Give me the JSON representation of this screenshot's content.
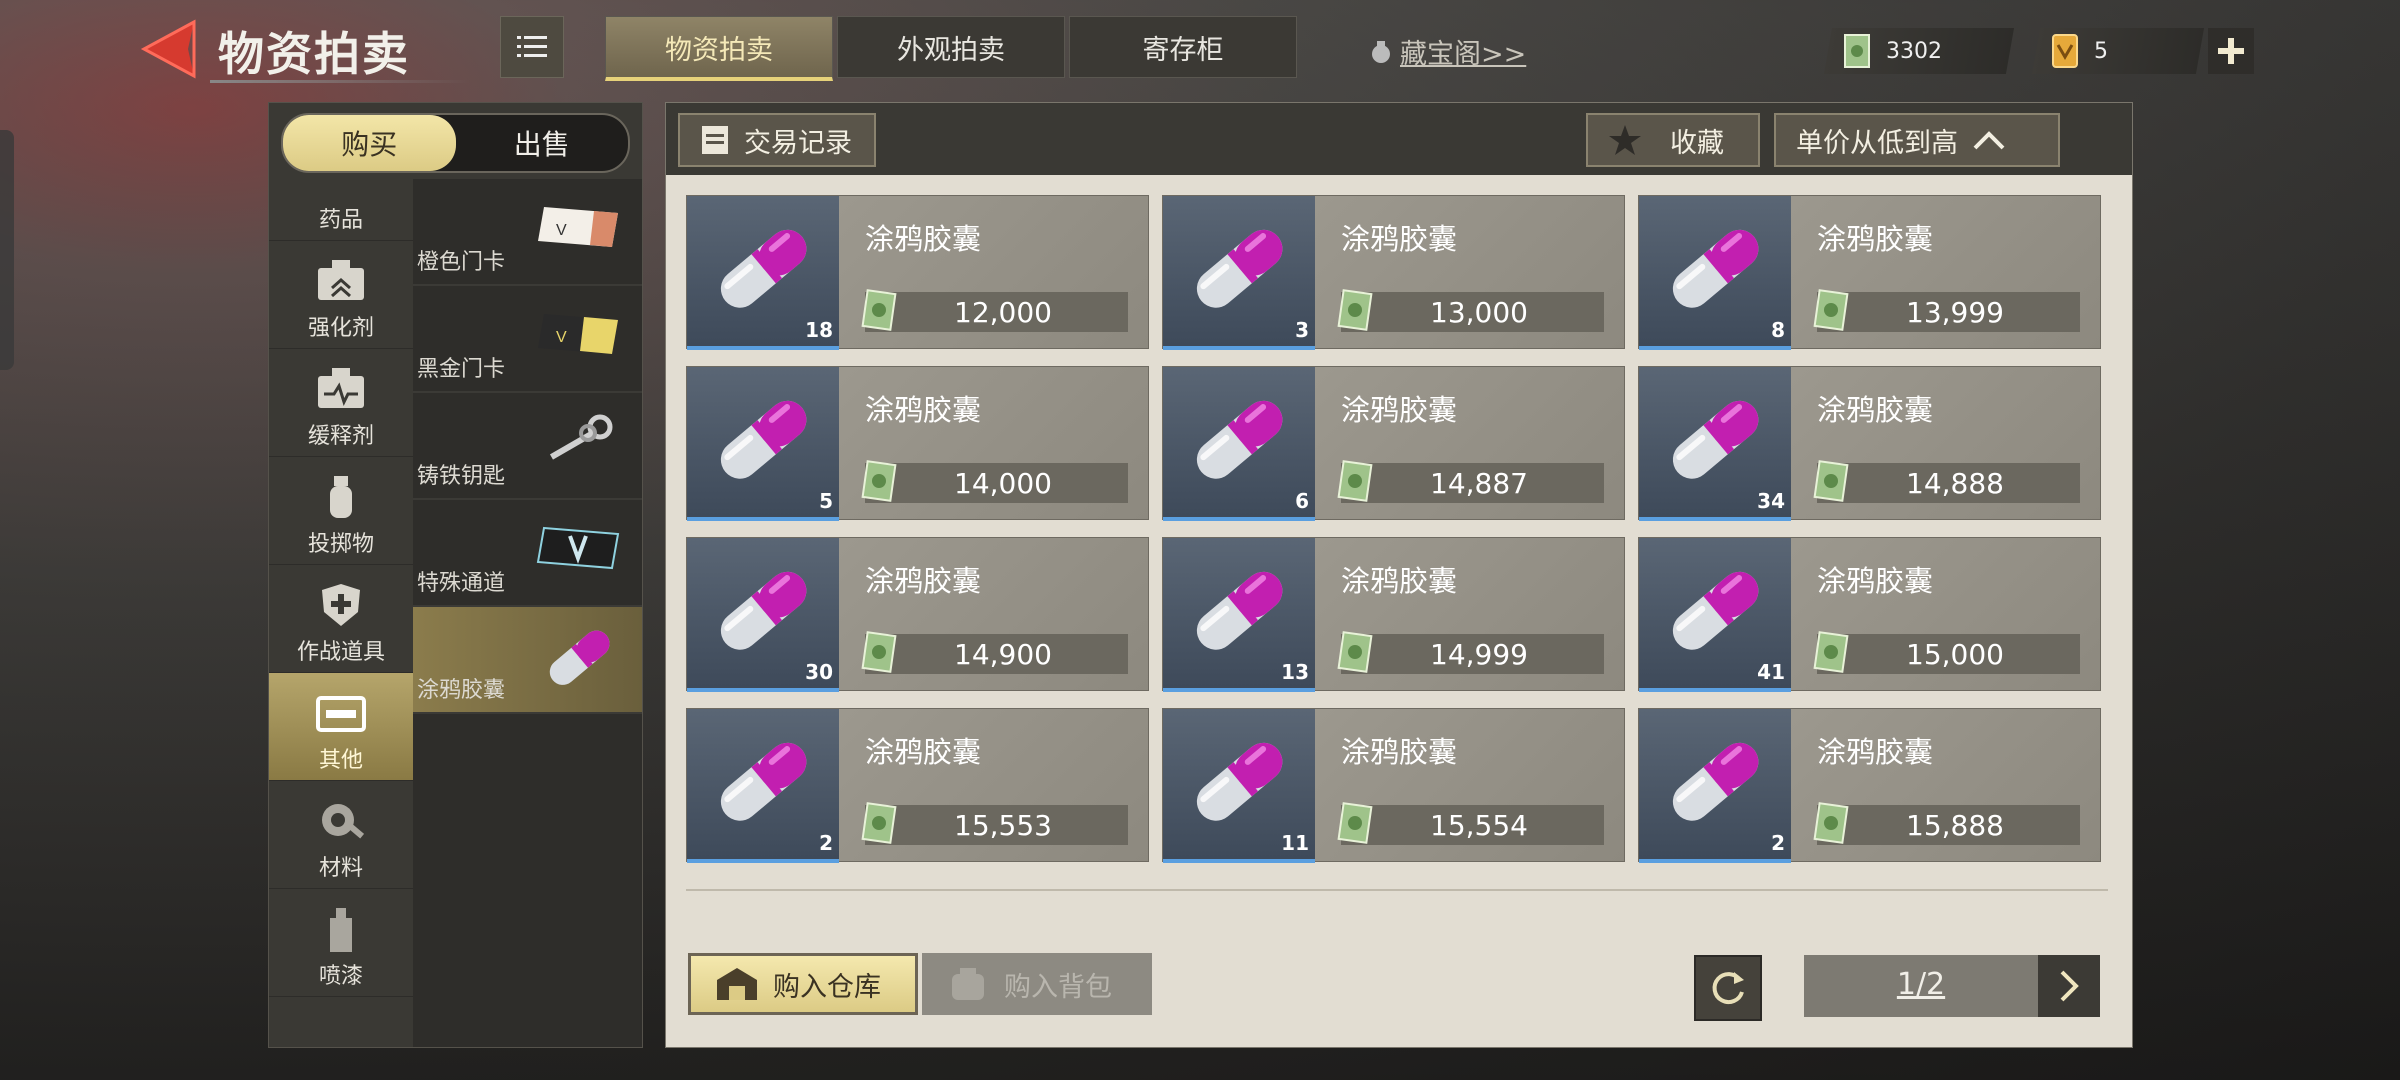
{
  "header": {
    "title": "物资拍卖",
    "tabs": [
      {
        "label": "物资拍卖",
        "active": true
      },
      {
        "label": "外观拍卖",
        "active": false
      },
      {
        "label": "寄存柜",
        "active": false
      }
    ],
    "treasure_link": "藏宝阁>>",
    "currency_cash": "3302",
    "currency_tickets": "5"
  },
  "sidebar": {
    "buy_label": "购买",
    "sell_label": "出售",
    "categories": [
      {
        "label": "药品",
        "icon": "medicine-icon"
      },
      {
        "label": "强化剂",
        "icon": "enhancer-icon"
      },
      {
        "label": "缓释剂",
        "icon": "slow-release-icon"
      },
      {
        "label": "投掷物",
        "icon": "grenade-icon"
      },
      {
        "label": "作战道具",
        "icon": "combat-shield-icon"
      },
      {
        "label": "其他",
        "icon": "box-icon",
        "active": true
      },
      {
        "label": "材料",
        "icon": "gear-wrench-icon"
      },
      {
        "label": "喷漆",
        "icon": "spray-can-icon"
      }
    ],
    "subcategories": [
      {
        "label": "橙色门卡"
      },
      {
        "label": "黑金门卡"
      },
      {
        "label": "铸铁钥匙"
      },
      {
        "label": "特殊通道"
      },
      {
        "label": "涂鸦胶囊",
        "active": true
      }
    ]
  },
  "toolbar": {
    "trade_log": "交易记录",
    "favorites": "收藏",
    "sort": "单价从低到高"
  },
  "items": [
    {
      "name": "涂鸦胶囊",
      "qty": "18",
      "price": "12,000"
    },
    {
      "name": "涂鸦胶囊",
      "qty": "3",
      "price": "13,000"
    },
    {
      "name": "涂鸦胶囊",
      "qty": "8",
      "price": "13,999"
    },
    {
      "name": "涂鸦胶囊",
      "qty": "5",
      "price": "14,000"
    },
    {
      "name": "涂鸦胶囊",
      "qty": "6",
      "price": "14,887"
    },
    {
      "name": "涂鸦胶囊",
      "qty": "34",
      "price": "14,888"
    },
    {
      "name": "涂鸦胶囊",
      "qty": "30",
      "price": "14,900"
    },
    {
      "name": "涂鸦胶囊",
      "qty": "13",
      "price": "14,999"
    },
    {
      "name": "涂鸦胶囊",
      "qty": "41",
      "price": "15,000"
    },
    {
      "name": "涂鸦胶囊",
      "qty": "2",
      "price": "15,553"
    },
    {
      "name": "涂鸦胶囊",
      "qty": "11",
      "price": "15,554"
    },
    {
      "name": "涂鸦胶囊",
      "qty": "2",
      "price": "15,888"
    }
  ],
  "footer": {
    "buy_warehouse": "购入仓库",
    "buy_bag": "购入背包",
    "page": "1/2"
  },
  "colors": {
    "accent": "#e7d27a",
    "back_arrow": "#d63a2f",
    "rarity_blue": "#5a9fe0",
    "capsule": "#c21fb0"
  }
}
